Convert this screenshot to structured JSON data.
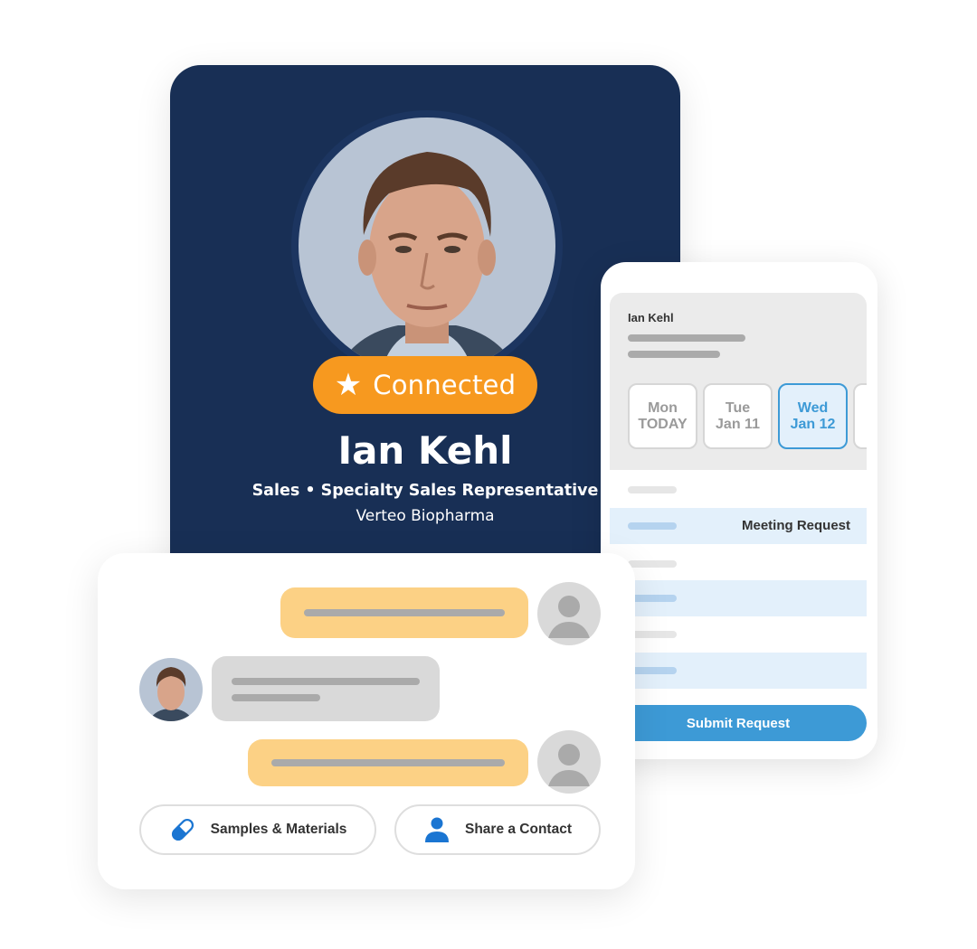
{
  "profile": {
    "badge_icon": "star-icon",
    "badge_label": "Connected",
    "name": "Ian Kehl",
    "role": "Sales • Specialty Sales Representative",
    "company": "Verteo Biopharma",
    "photo_icon": "profile-photo"
  },
  "meeting": {
    "contact_name": "Ian Kehl",
    "dates": [
      {
        "day": "Mon",
        "date": "TODAY",
        "selected": false
      },
      {
        "day": "Tue",
        "date": "Jan 11",
        "selected": false
      },
      {
        "day": "Wed",
        "date": "Jan 12",
        "selected": true
      },
      {
        "day": "",
        "date": "",
        "selected": false
      }
    ],
    "slots": [
      {
        "label": "",
        "highlighted": false
      },
      {
        "label": "Meeting Request",
        "highlighted": true
      },
      {
        "label": "",
        "highlighted": false
      },
      {
        "label": "",
        "highlighted": true
      },
      {
        "label": "",
        "highlighted": false
      },
      {
        "label": "",
        "highlighted": true
      }
    ],
    "submit_label": "Submit Request"
  },
  "chat": {
    "messages": [
      {
        "direction": "outgoing",
        "avatar": "generic-user-icon"
      },
      {
        "direction": "incoming",
        "avatar": "rep-photo"
      },
      {
        "direction": "outgoing",
        "avatar": "generic-user-icon"
      }
    ],
    "actions": [
      {
        "label": "Samples & Materials",
        "icon": "pill-capsule-icon"
      },
      {
        "label": "Share a Contact",
        "icon": "person-icon"
      }
    ]
  },
  "colors": {
    "navy": "#182f55",
    "orange": "#f7991f",
    "blue": "#3d9ad6",
    "light_blue": "#e3f0fb",
    "bubble_yellow": "#fcd185",
    "bubble_gray": "#d9d9d9",
    "icon_blue": "#1a75d2"
  }
}
